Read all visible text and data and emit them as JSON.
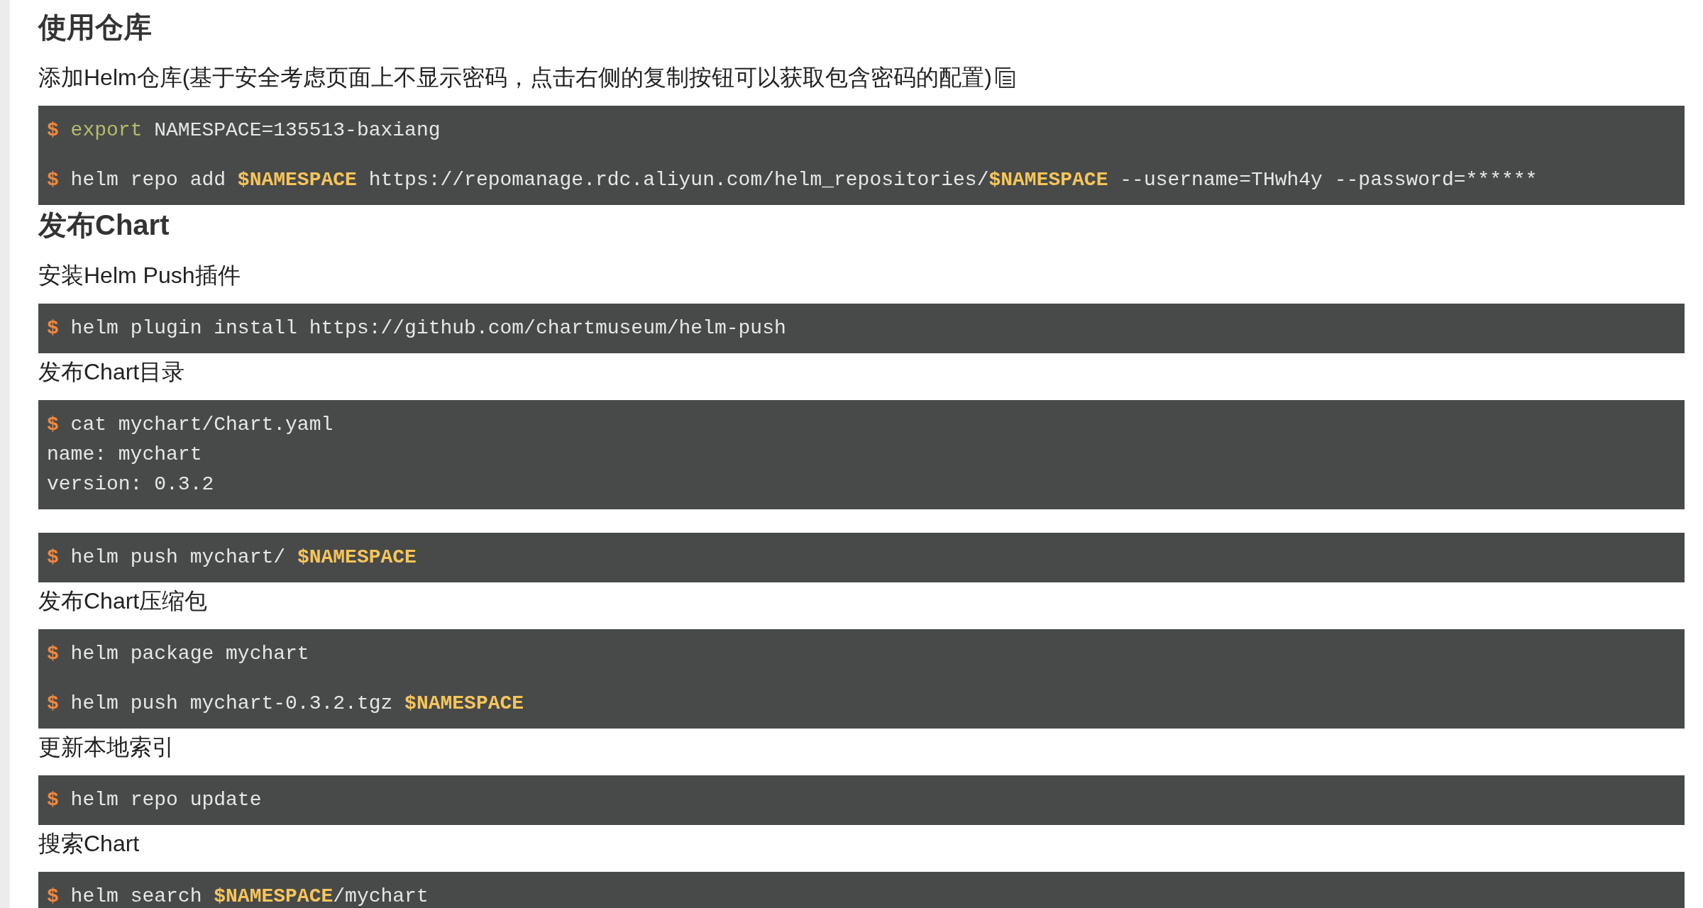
{
  "sections": [
    {
      "kind": "heading",
      "text": "使用仓库"
    },
    {
      "kind": "paragraph_with_copy",
      "text": "添加Helm仓库(基于安全考虑页面上不显示密码，点击右侧的复制按钮可以获取包含密码的配置)"
    },
    {
      "kind": "code_spaced",
      "lines": [
        [
          {
            "kind": "prompt",
            "text": "$"
          },
          {
            "kind": "keyword",
            "text": " export"
          },
          {
            "kind": "text",
            "text": " NAMESPACE=135513-baxiang"
          }
        ],
        [
          {
            "kind": "prompt",
            "text": "$"
          },
          {
            "kind": "text",
            "text": " helm repo add "
          },
          {
            "kind": "variable",
            "text": "$NAMESPACE"
          },
          {
            "kind": "text",
            "text": " https://repomanage.rdc.aliyun.com/helm_repositories/"
          },
          {
            "kind": "variable",
            "text": "$NAMESPACE"
          },
          {
            "kind": "text",
            "text": " --username=THwh4y --password=******"
          }
        ]
      ]
    },
    {
      "kind": "heading",
      "text": "发布Chart"
    },
    {
      "kind": "paragraph",
      "text": "安装Helm Push插件"
    },
    {
      "kind": "code",
      "lines": [
        [
          {
            "kind": "prompt",
            "text": "$"
          },
          {
            "kind": "text",
            "text": " helm plugin install https://github.com/chartmuseum/helm-push"
          }
        ]
      ]
    },
    {
      "kind": "paragraph",
      "text": "发布Chart目录"
    },
    {
      "kind": "code",
      "lines": [
        [
          {
            "kind": "prompt",
            "text": "$"
          },
          {
            "kind": "text",
            "text": " cat mychart/Chart.yaml"
          }
        ],
        [
          {
            "kind": "text",
            "text": "name: mychart"
          }
        ],
        [
          {
            "kind": "text",
            "text": "version: 0.3.2"
          }
        ]
      ]
    },
    {
      "kind": "code",
      "lines": [
        [
          {
            "kind": "prompt",
            "text": "$"
          },
          {
            "kind": "text",
            "text": " helm push mychart/ "
          },
          {
            "kind": "variable",
            "text": "$NAMESPACE"
          }
        ]
      ]
    },
    {
      "kind": "paragraph",
      "text": "发布Chart压缩包"
    },
    {
      "kind": "code_spaced",
      "lines": [
        [
          {
            "kind": "prompt",
            "text": "$"
          },
          {
            "kind": "text",
            "text": " helm package mychart"
          }
        ],
        [
          {
            "kind": "prompt",
            "text": "$"
          },
          {
            "kind": "text",
            "text": " helm push mychart-0.3.2.tgz "
          },
          {
            "kind": "variable",
            "text": "$NAMESPACE"
          }
        ]
      ]
    },
    {
      "kind": "paragraph",
      "text": "更新本地索引"
    },
    {
      "kind": "code",
      "lines": [
        [
          {
            "kind": "prompt",
            "text": "$"
          },
          {
            "kind": "text",
            "text": " helm repo update"
          }
        ]
      ]
    },
    {
      "kind": "paragraph",
      "text": "搜索Chart"
    },
    {
      "kind": "code",
      "lines": [
        [
          {
            "kind": "prompt",
            "text": "$"
          },
          {
            "kind": "text",
            "text": " helm search "
          },
          {
            "kind": "variable",
            "text": "$NAMESPACE"
          },
          {
            "kind": "text",
            "text": "/mychart"
          }
        ]
      ]
    }
  ]
}
